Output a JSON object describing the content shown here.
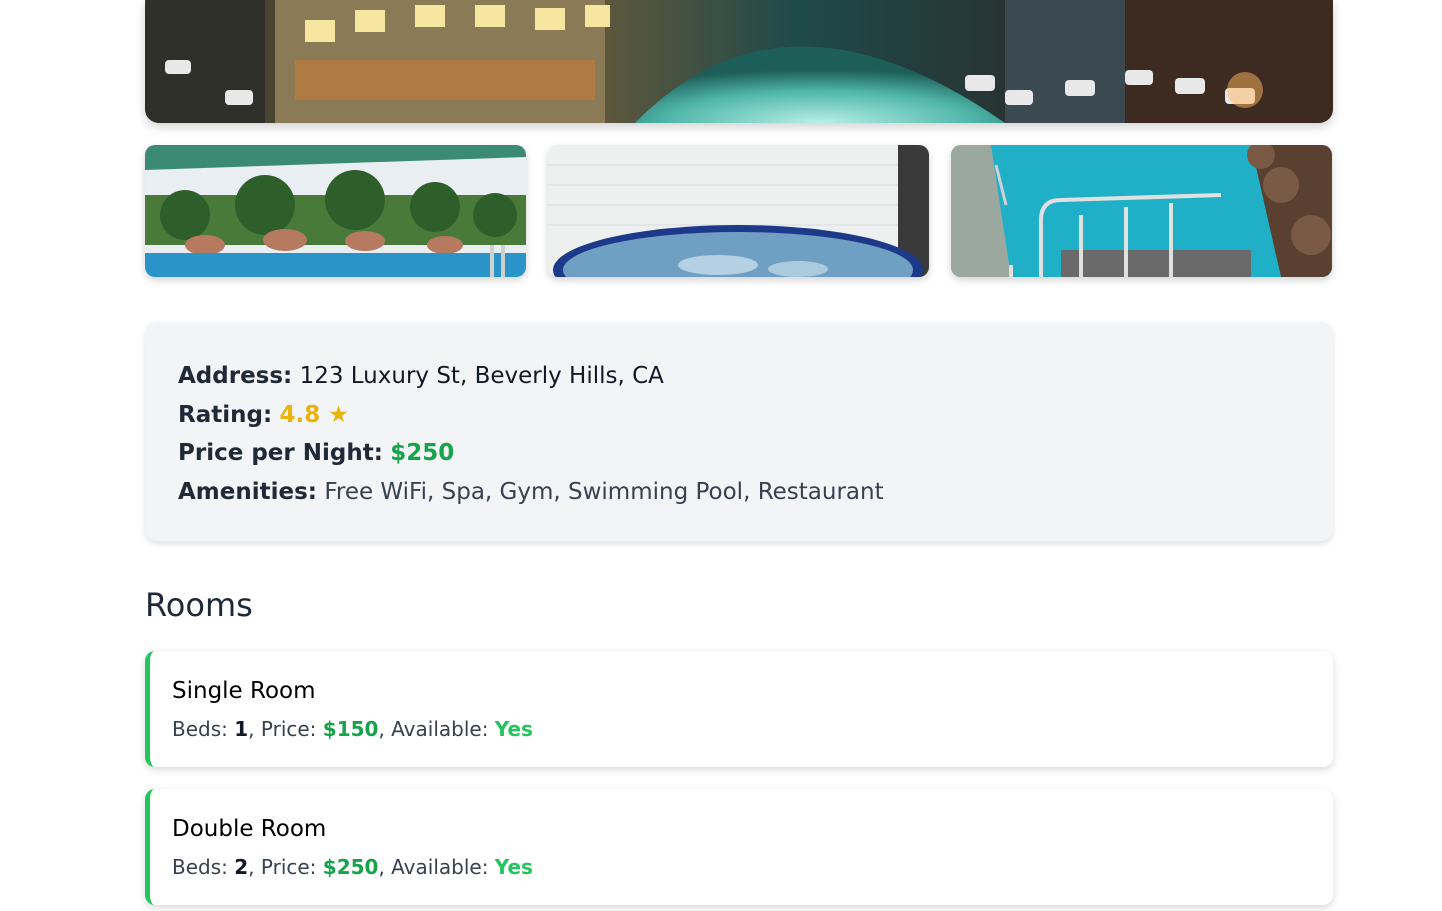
{
  "hotel": {
    "images": {
      "hero": "hotel-exterior-night",
      "thumbnails": [
        "outdoor-pool",
        "indoor-jacuzzi",
        "pool-with-ladder"
      ]
    },
    "info": {
      "address_label": "Address:",
      "address": "123 Luxury St, Beverly Hills, CA",
      "rating_label": "Rating:",
      "rating": "4.8 ★",
      "price_label": "Price per Night:",
      "price": "$250",
      "amenities_label": "Amenities:",
      "amenities": "Free WiFi, Spa, Gym, Swimming Pool, Restaurant"
    }
  },
  "rooms": {
    "title": "Rooms",
    "items": [
      {
        "name": "Single Room",
        "beds_label": "Beds: ",
        "beds": "1",
        "price_label": ", Price: ",
        "price": "$150",
        "available_label": ", Available: ",
        "available": "Yes"
      },
      {
        "name": "Double Room",
        "beds_label": "Beds: ",
        "beds": "2",
        "price_label": ", Price: ",
        "price": "$250",
        "available_label": ", Available: ",
        "available": "Yes"
      }
    ]
  },
  "colors": {
    "accent_green": "#22c55e",
    "price_green": "#16a34a",
    "rating_gold": "#eab308",
    "card_bg": "#f3f4f6"
  }
}
